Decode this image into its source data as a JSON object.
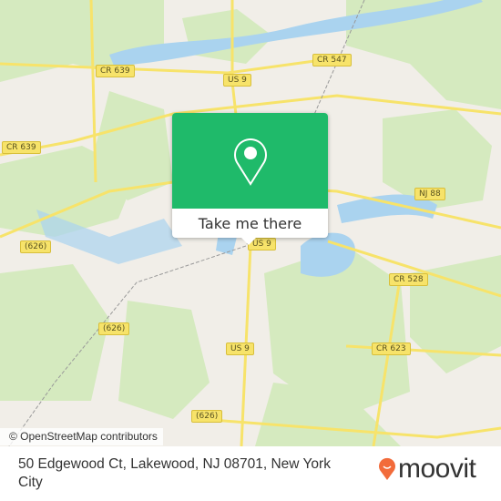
{
  "map": {
    "road_labels": [
      "CR 639",
      "US 9",
      "CR 547",
      "CR 639",
      "NJ 88",
      "(626)",
      "US 9",
      "CR 528",
      "(626)",
      "US 9",
      "CR 623",
      "(626)"
    ],
    "attribution": "© OpenStreetMap contributors",
    "colors": {
      "land": "#f1eee8",
      "forest": "#d5eabf",
      "water": "#aad3ef",
      "road": "#f7e36a",
      "accent": "#1fba6a"
    }
  },
  "popup": {
    "icon": "location-pin-icon",
    "button_label": "Take me there"
  },
  "footer": {
    "address": "50 Edgewood Ct, Lakewood, NJ 08701, New York City",
    "brand": "moovit",
    "brand_color": "#f26b3a"
  }
}
